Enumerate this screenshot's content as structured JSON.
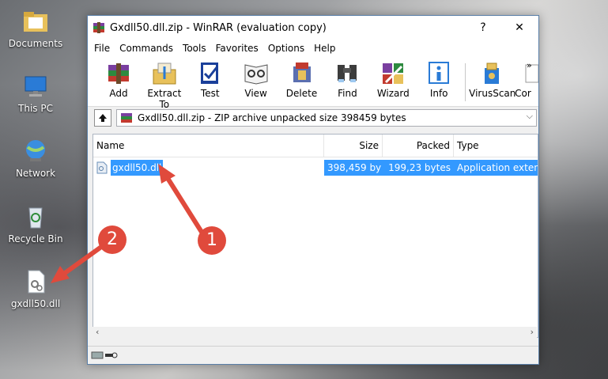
{
  "desktop": {
    "icons": [
      {
        "label": "Documents"
      },
      {
        "label": "This PC"
      },
      {
        "label": "Network"
      },
      {
        "label": "Recycle Bin"
      },
      {
        "label": "gxdll50.dll"
      }
    ]
  },
  "window": {
    "title": "Gxdll50.dll.zip - WinRAR (evaluation copy)",
    "help_symbol": "?",
    "close_symbol": "✕"
  },
  "menu": [
    "File",
    "Commands",
    "Tools",
    "Favorites",
    "Options",
    "Help"
  ],
  "toolbar": [
    "Add",
    "Extract To",
    "Test",
    "View",
    "Delete",
    "Find",
    "Wizard",
    "Info",
    "VirusScan",
    "Cor"
  ],
  "address": {
    "path": "Gxdll50.dll.zip - ZIP archive unpacked size 398459 bytes"
  },
  "columns": [
    "Name",
    "Size",
    "Packed",
    "Type"
  ],
  "rows": [
    {
      "name": "gxdll50.dll",
      "size": "398,459 by",
      "packed": "199,23 bytes",
      "type": "Application exten"
    }
  ],
  "annotations": [
    "1",
    "2"
  ],
  "colors": {
    "selection": "#3399ff",
    "badge": "#e04a3c",
    "window_border": "#5a7fa8"
  }
}
